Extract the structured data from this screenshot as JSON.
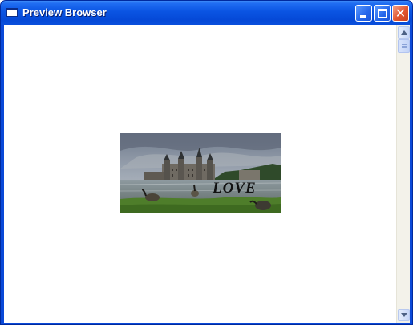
{
  "window": {
    "title": "Preview Browser",
    "title_bar_color": "#0a54e2",
    "close_button_color": "#e2552f"
  },
  "controls": {
    "minimize_icon": "minimize-icon",
    "maximize_icon": "maximize-icon",
    "close_icon": "close-icon",
    "close_glyph": "✕"
  },
  "content": {
    "image_icon": "castle-photo",
    "image_caption": "LOVE"
  },
  "scrollbar": {
    "up_icon": "arrow-up-icon",
    "down_icon": "arrow-down-icon",
    "position": 0
  }
}
